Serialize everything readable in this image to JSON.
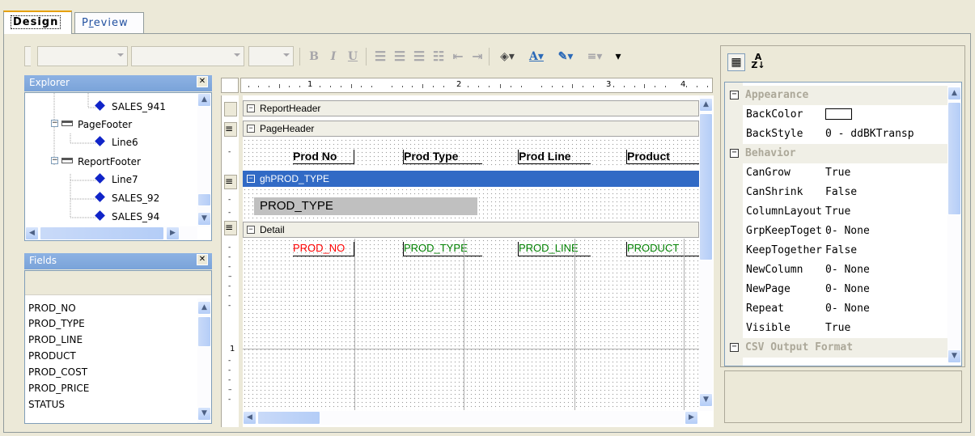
{
  "tabs": {
    "design": "Design",
    "preview_p": "P",
    "preview_r": "r",
    "preview_rest": "eview"
  },
  "toolbar": {
    "bold": "B",
    "italic": "I",
    "underline": "U"
  },
  "explorer": {
    "title": "Explorer",
    "items": [
      "SALES_941",
      "PageFooter",
      "Line6",
      "ReportFooter",
      "Line7",
      "SALES_92",
      "SALES_94"
    ]
  },
  "fields": {
    "title": "Fields",
    "items": [
      "PROD_NO",
      "PROD_TYPE",
      "PROD_LINE",
      "PRODUCT",
      "PROD_COST",
      "PROD_PRICE",
      "STATUS"
    ]
  },
  "ruler": {
    "marks": [
      "1",
      "2",
      "3",
      "4"
    ],
    "vmark": "1"
  },
  "bands": {
    "report_header": "ReportHeader",
    "page_header": "PageHeader",
    "group_header": "ghPROD_TYPE",
    "detail": "Detail"
  },
  "page_header_labels": [
    "Prod No",
    "Prod Type",
    "Prod Line",
    "Product"
  ],
  "group_field": "PROD_TYPE",
  "detail_fields": [
    {
      "text": "PROD_NO",
      "color": "#ff0000"
    },
    {
      "text": "PROD_TYPE",
      "color": "#008000"
    },
    {
      "text": "PROD_LINE",
      "color": "#008000"
    },
    {
      "text": "PRODUCT",
      "color": "#008000"
    }
  ],
  "properties": {
    "rows": [
      {
        "type": "cat",
        "name": "Appearance"
      },
      {
        "type": "prop",
        "name": "BackColor",
        "value": ""
      },
      {
        "type": "prop",
        "name": "BackStyle",
        "value": "0 - ddBKTransp"
      },
      {
        "type": "cat",
        "name": "Behavior"
      },
      {
        "type": "prop",
        "name": "CanGrow",
        "value": "True"
      },
      {
        "type": "prop",
        "name": "CanShrink",
        "value": "False"
      },
      {
        "type": "prop",
        "name": "ColumnLayout",
        "value": "True"
      },
      {
        "type": "prop",
        "name": "GrpKeepTogether",
        "value": "0- None"
      },
      {
        "type": "prop",
        "name": "KeepTogether",
        "value": "False"
      },
      {
        "type": "prop",
        "name": "NewColumn",
        "value": "0- None"
      },
      {
        "type": "prop",
        "name": "NewPage",
        "value": "0- None"
      },
      {
        "type": "prop",
        "name": "Repeat",
        "value": "0- None"
      },
      {
        "type": "prop",
        "name": "Visible",
        "value": "True"
      },
      {
        "type": "cat",
        "name": "CSV Output Format"
      }
    ]
  },
  "colors": {
    "selected_band": "#316ac5",
    "panel_header": "#7aa3d9"
  }
}
